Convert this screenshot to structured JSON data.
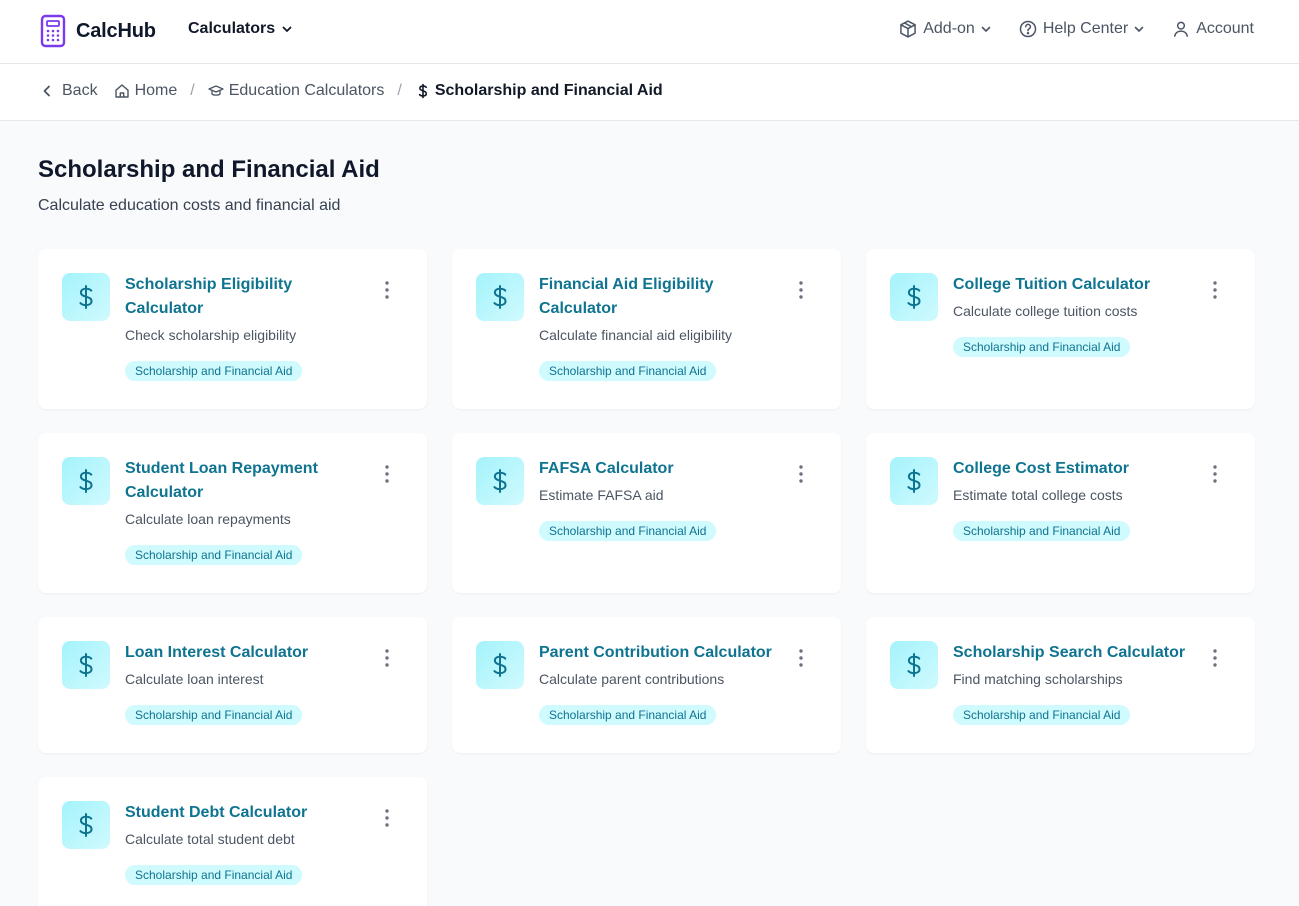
{
  "brand": {
    "name": "CalcHub"
  },
  "nav": {
    "calculators_label": "Calculators",
    "addon_label": "Add-on",
    "help_label": "Help Center",
    "account_label": "Account"
  },
  "breadcrumb": {
    "back": "Back",
    "home": "Home",
    "category": "Education Calculators",
    "current": "Scholarship and Financial Aid",
    "separator": "/"
  },
  "page": {
    "title": "Scholarship and Financial Aid",
    "subtitle": "Calculate education costs and financial aid"
  },
  "cards": [
    {
      "title": "Scholarship Eligibility Calculator",
      "desc": "Check scholarship eligibility",
      "tag": "Scholarship and Financial Aid",
      "icon": "dollar-icon"
    },
    {
      "title": "Financial Aid Eligibility Calculator",
      "desc": "Calculate financial aid eligibility",
      "tag": "Scholarship and Financial Aid",
      "icon": "dollar-icon"
    },
    {
      "title": "College Tuition Calculator",
      "desc": "Calculate college tuition costs",
      "tag": "Scholarship and Financial Aid",
      "icon": "dollar-icon"
    },
    {
      "title": "Student Loan Repayment Calculator",
      "desc": "Calculate loan repayments",
      "tag": "Scholarship and Financial Aid",
      "icon": "dollar-icon"
    },
    {
      "title": "FAFSA Calculator",
      "desc": "Estimate FAFSA aid",
      "tag": "Scholarship and Financial Aid",
      "icon": "dollar-icon"
    },
    {
      "title": "College Cost Estimator",
      "desc": "Estimate total college costs",
      "tag": "Scholarship and Financial Aid",
      "icon": "dollar-icon"
    },
    {
      "title": "Loan Interest Calculator",
      "desc": "Calculate loan interest",
      "tag": "Scholarship and Financial Aid",
      "icon": "dollar-icon"
    },
    {
      "title": "Parent Contribution Calculator",
      "desc": "Calculate parent contributions",
      "tag": "Scholarship and Financial Aid",
      "icon": "dollar-icon"
    },
    {
      "title": "Scholarship Search Calculator",
      "desc": "Find matching scholarships",
      "tag": "Scholarship and Financial Aid",
      "icon": "dollar-icon"
    },
    {
      "title": "Student Debt Calculator",
      "desc": "Calculate total student debt",
      "tag": "Scholarship and Financial Aid",
      "icon": "dollar-icon"
    }
  ],
  "colors": {
    "brand": "#7c3aed",
    "accent": "#0e7490",
    "tag_bg": "#cffafe",
    "icon_bg": "#a5f3fc"
  }
}
